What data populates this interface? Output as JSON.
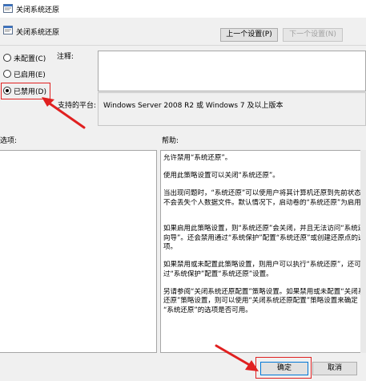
{
  "window": {
    "title": "关闭系统还原",
    "icon": "policy-icon"
  },
  "header": {
    "title": "关闭系统还原",
    "icon": "policy-icon",
    "prev_label": "上一个设置(P)",
    "next_label": "下一个设置(N)"
  },
  "options": {
    "not_configured": "未配置(C)",
    "enabled": "已启用(E)",
    "disabled": "已禁用(D)",
    "selected": "disabled"
  },
  "comment": {
    "label": "注释:",
    "value": ""
  },
  "platform": {
    "label": "支持的平台:",
    "value": "Windows Server 2008 R2 或 Windows 7 及以上版本"
  },
  "sections": {
    "options_label": "选项:",
    "help_label": "帮助:"
  },
  "help": {
    "lines": [
      "允许禁用“系统还原”。",
      "",
      "使用此策略设置可以关闭“系统还原”。",
      "",
      "当出现问题时，“系统还原”可以使用户将其计算机还原到先前状态，",
      "不会丢失个人数据文件。默认情况下，启动卷的“系统还原”为启用状态。",
      "",
      "",
      "如果启用此策略设置，则“系统还原”会关闭，并且无法访问“系统还原",
      "向导”。还会禁用通过“系统保护”配置“系统还原”或创建还原点的选",
      "项。",
      "",
      "如果禁用或未配置此策略设置，则用户可以执行“系统还原”，还可以通",
      "过“系统保护”配置“系统还原”设置。",
      "",
      "另请参阅“关闭系统还原配置”策略设置。如果禁用或未配置“关闭系统",
      "还原”策略设置，则可以使用“关闭系统还原配置”策略设置来确定",
      "“系统还原”的选项是否可用。"
    ]
  },
  "footer": {
    "ok_label": "确定",
    "cancel_label": "取消"
  },
  "colors": {
    "highlight_red": "#e02020",
    "window_bg": "#f0f0f0"
  }
}
